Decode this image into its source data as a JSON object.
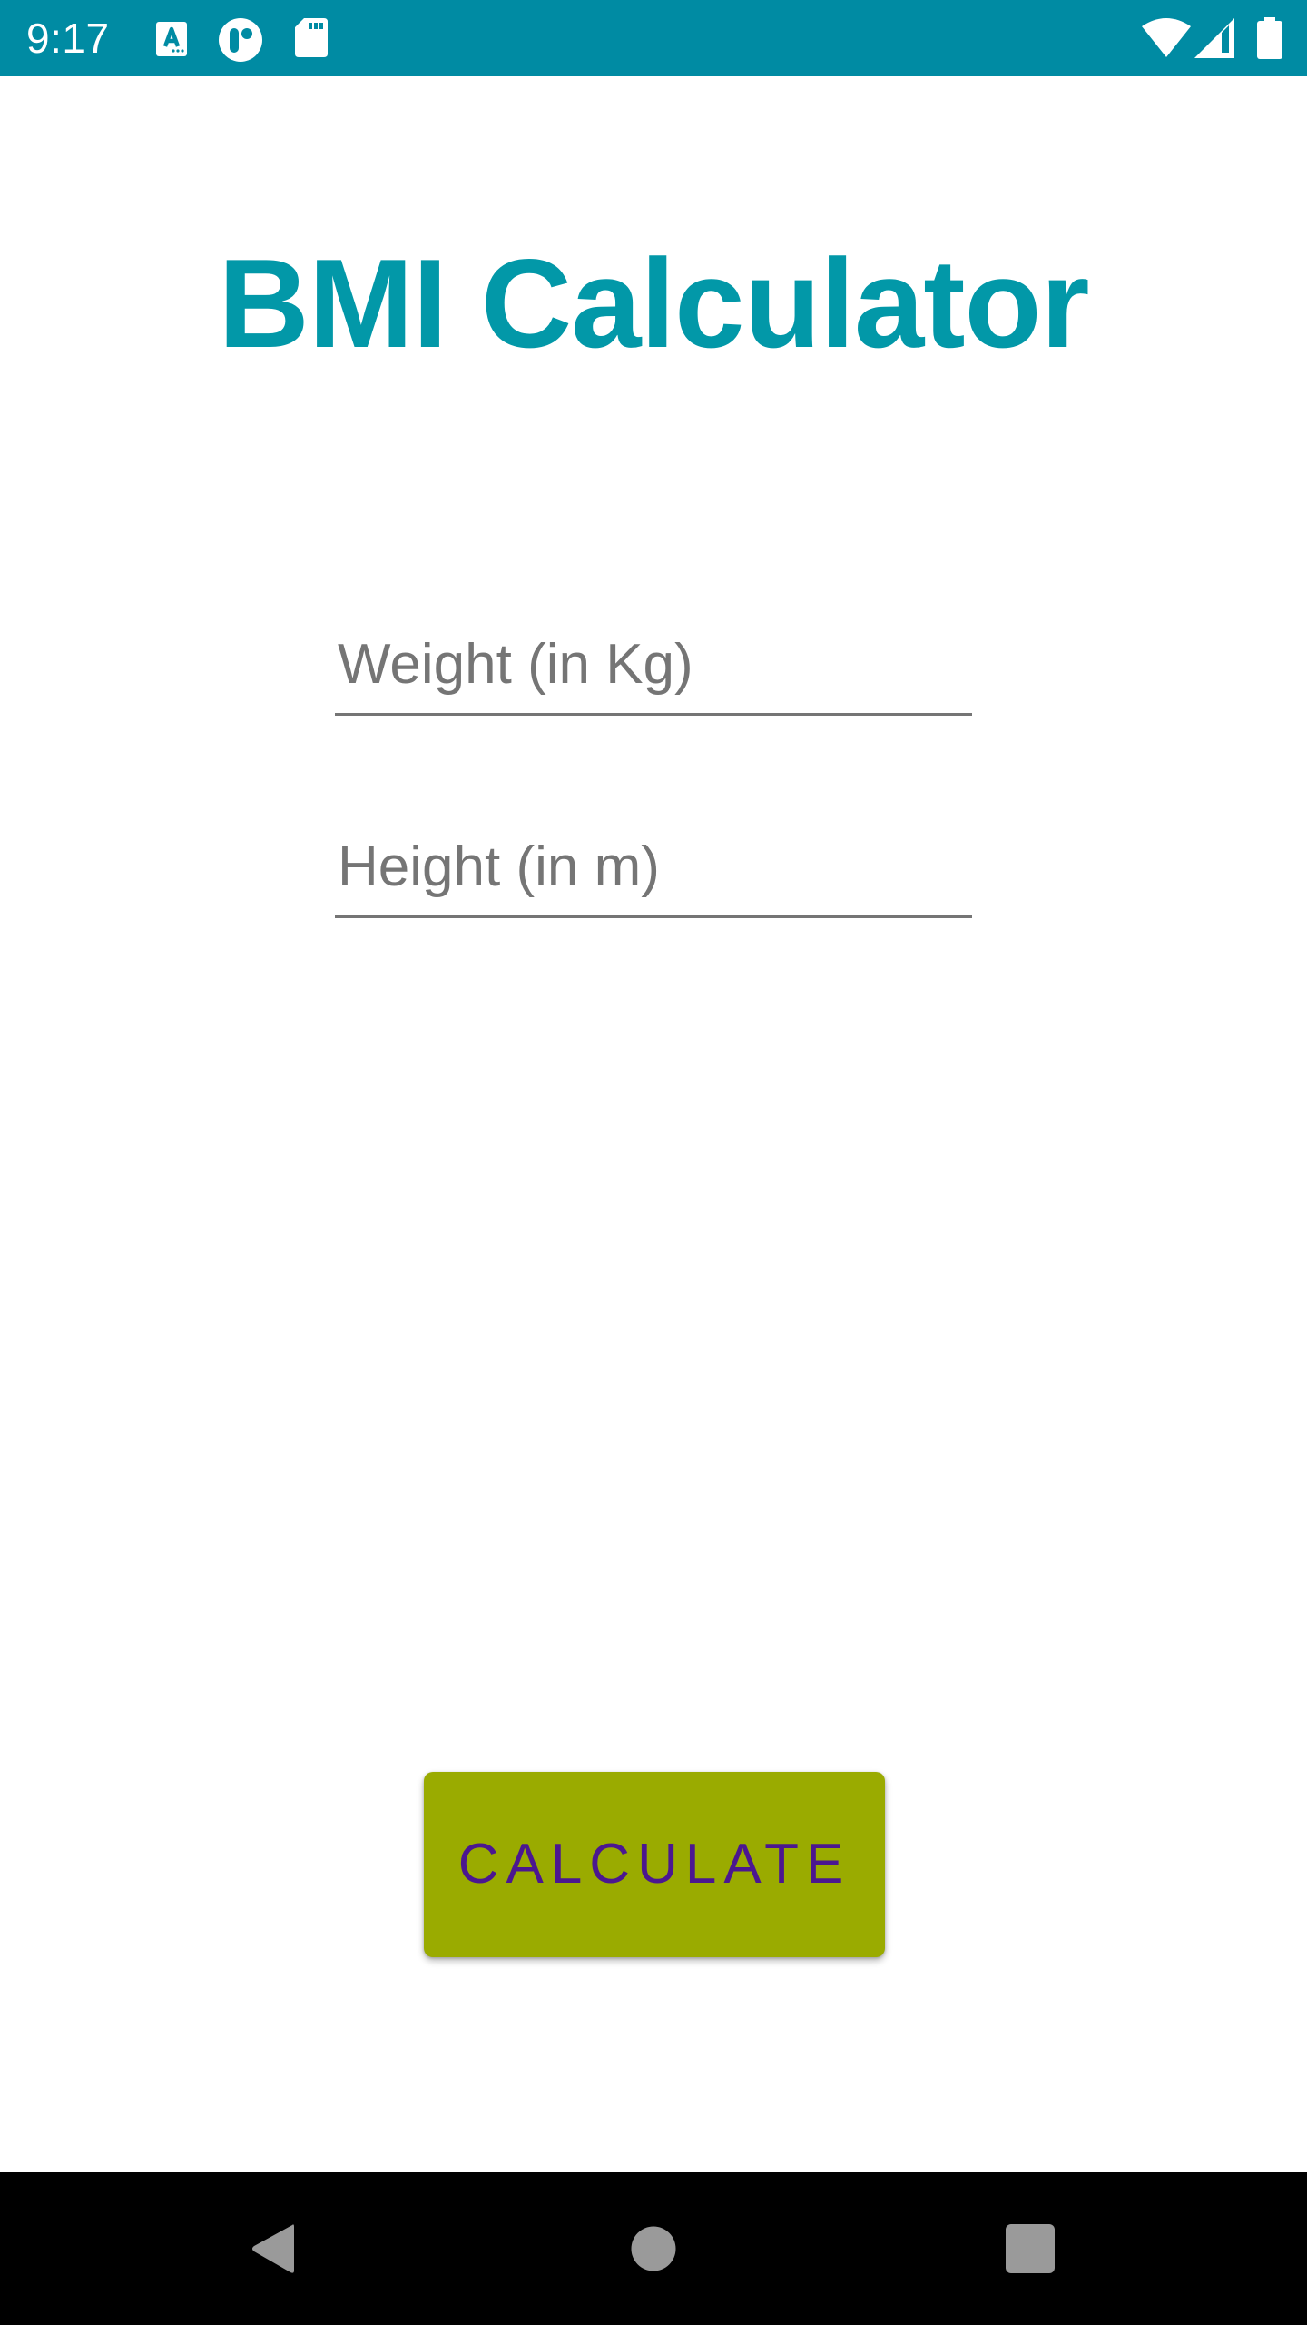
{
  "status_bar": {
    "time": "9:17",
    "background_color": "#008BA3",
    "left_icons": [
      "accessibility-a-icon",
      "app-circle-icon",
      "sd-card-icon"
    ],
    "right_icons": [
      "wifi-icon",
      "cell-signal-icon",
      "battery-icon"
    ]
  },
  "app": {
    "title": "BMI Calculator",
    "title_color": "#0298A8",
    "fields": [
      {
        "name": "weight",
        "value": "",
        "placeholder": "Weight (in Kg)"
      },
      {
        "name": "height",
        "value": "",
        "placeholder": "Height (in m)"
      }
    ],
    "calculate_button": {
      "label": "CALCULATE",
      "background_color": "#9AAB00",
      "text_color": "#4B1790"
    }
  },
  "nav_bar": {
    "buttons": [
      "back",
      "home",
      "recents"
    ]
  }
}
